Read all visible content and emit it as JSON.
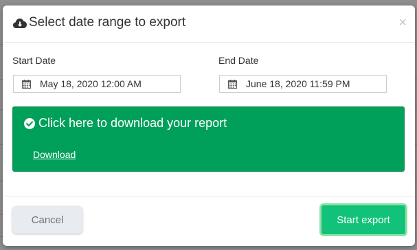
{
  "dialog": {
    "title": "Select date range to export",
    "close_label": "×",
    "title_icon": "cloud-download-icon"
  },
  "start_date": {
    "label": "Start Date",
    "value": "May 18, 2020 12:00 AM",
    "icon": "calendar-icon"
  },
  "end_date": {
    "label": "End Date",
    "value": "June 18, 2020 11:59 PM",
    "icon": "calendar-icon"
  },
  "success": {
    "message": "Click here to download your report",
    "link_label": "Download",
    "icon": "check-circle-icon",
    "color": "#00a05a"
  },
  "footer": {
    "cancel_label": "Cancel",
    "export_label": "Start export",
    "export_color": "#12c27a"
  }
}
